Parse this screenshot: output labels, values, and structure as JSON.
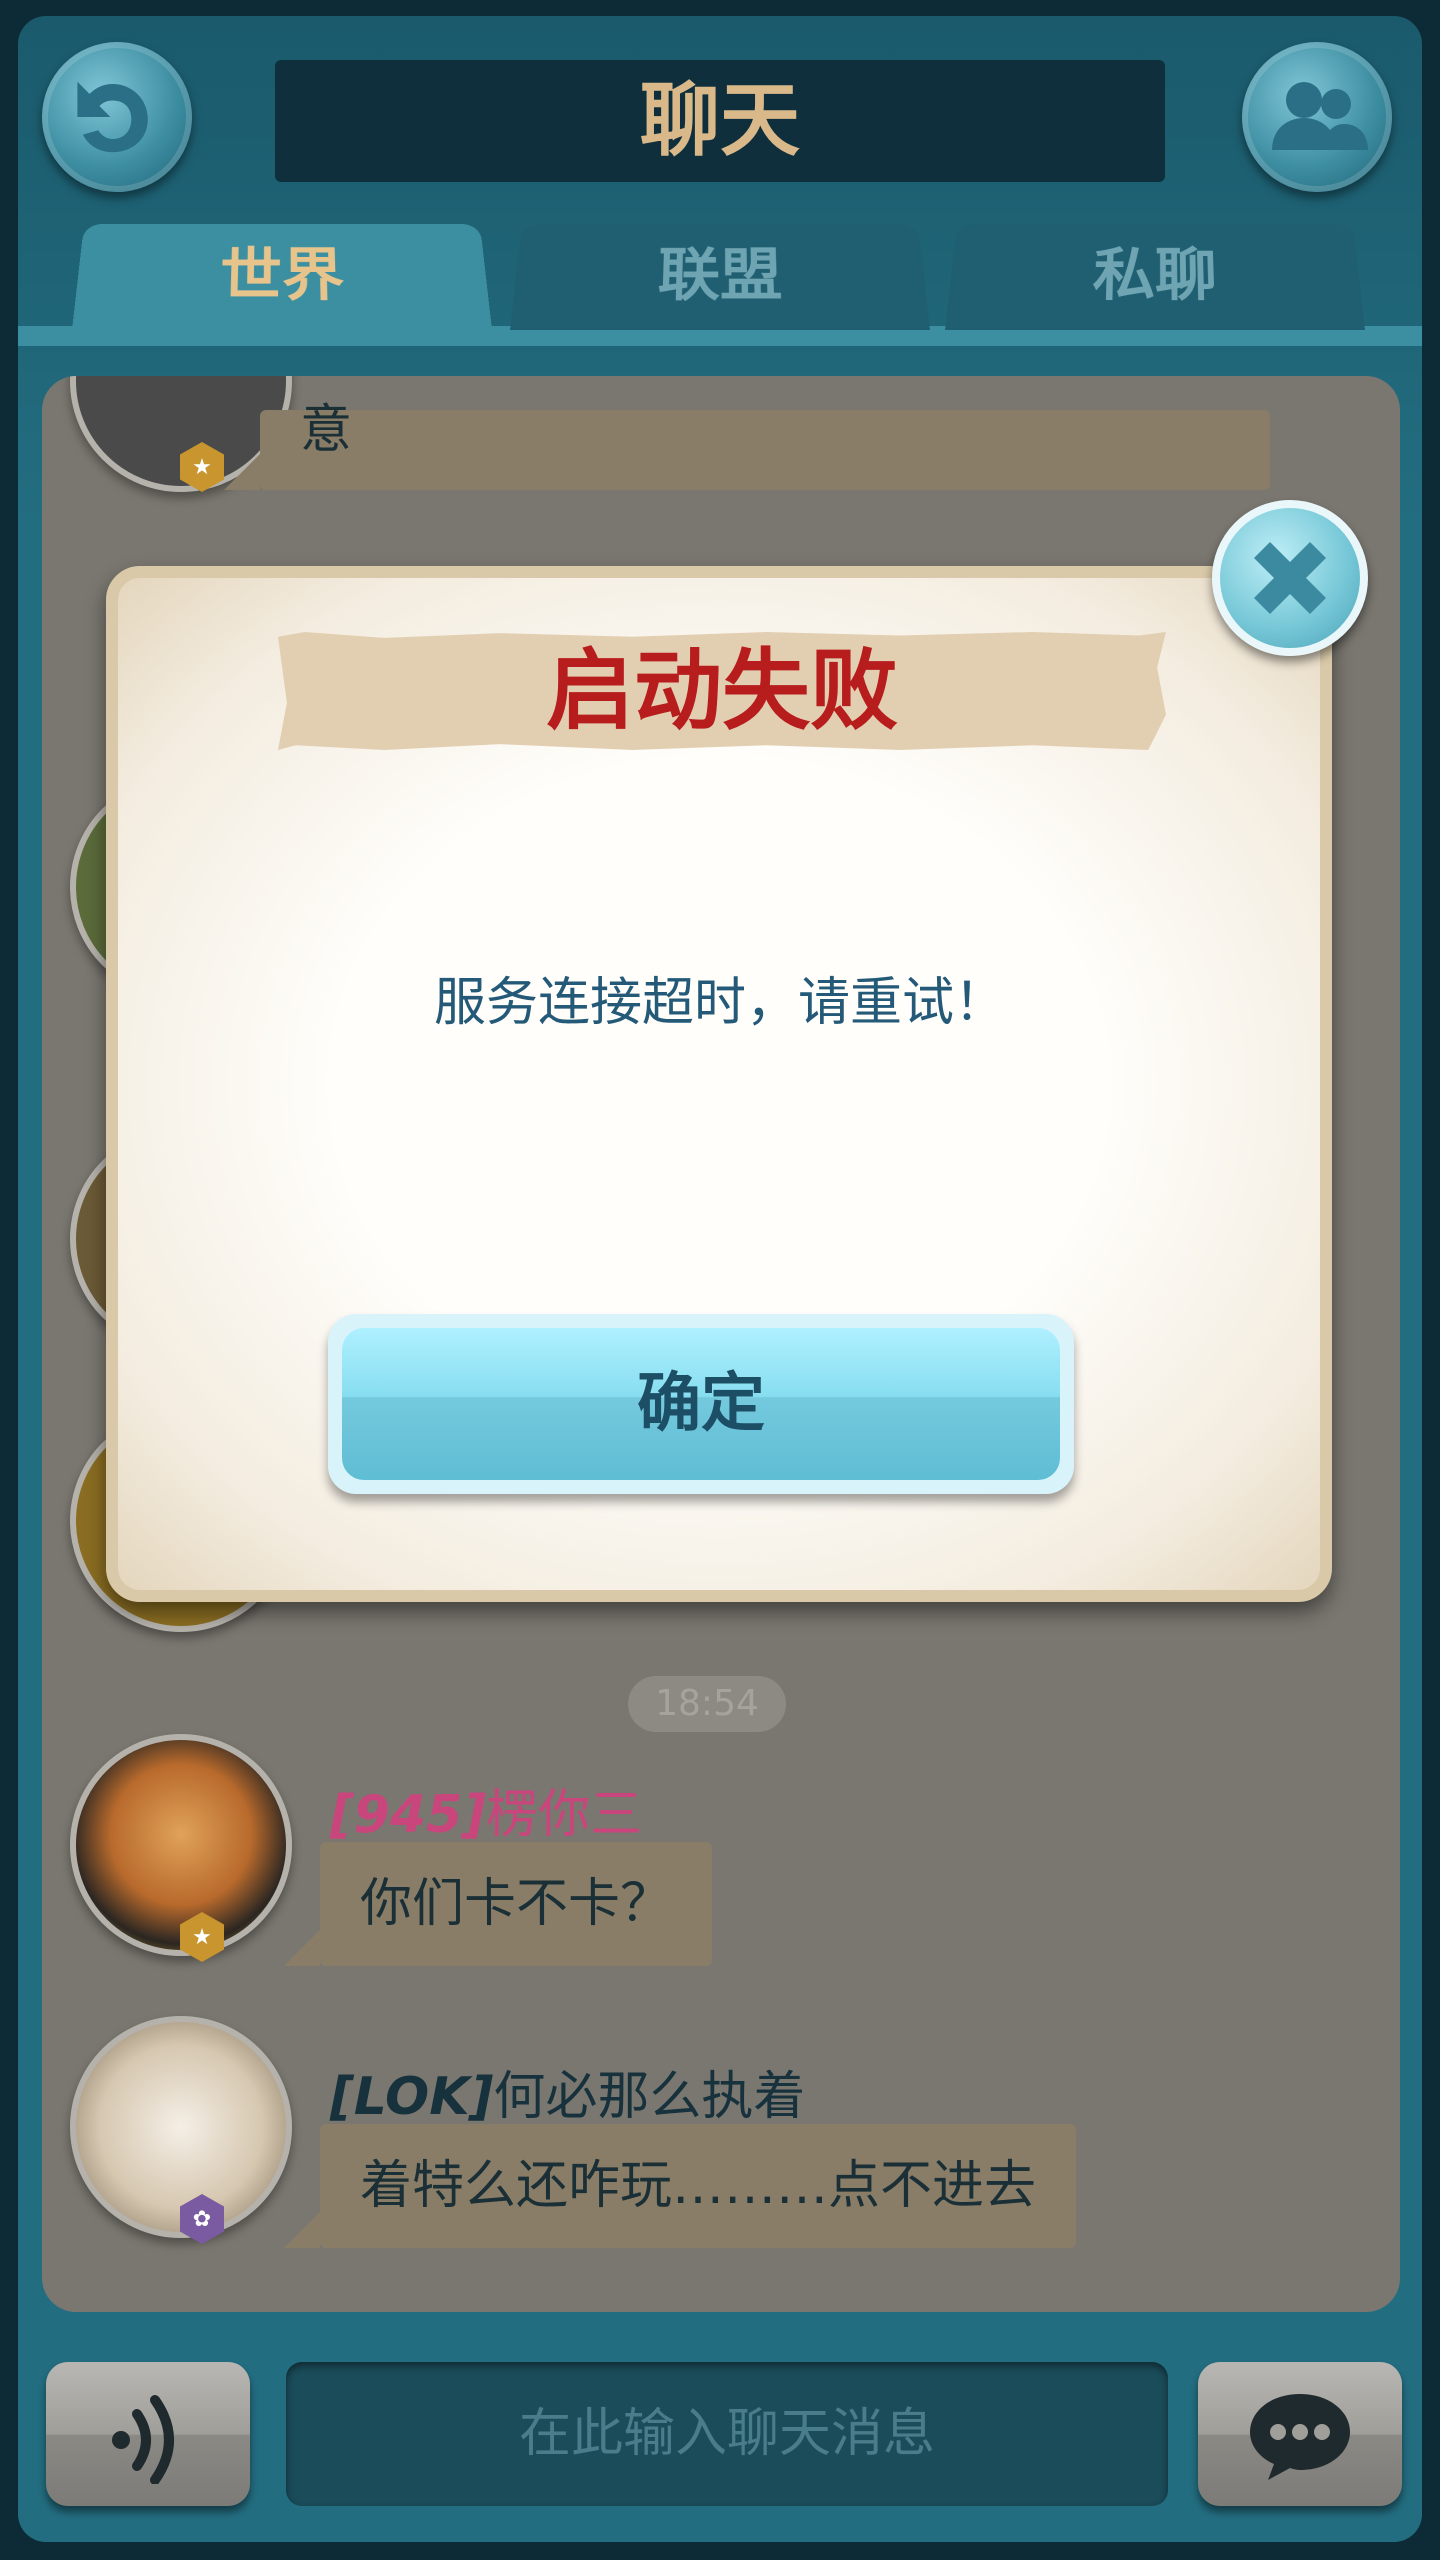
{
  "header": {
    "title": "聊天"
  },
  "tabs": [
    {
      "label": "世界",
      "active": true
    },
    {
      "label": "联盟",
      "active": false
    },
    {
      "label": "私聊",
      "active": false
    }
  ],
  "chat": {
    "top_partial_message": "意",
    "timestamp": "18:54",
    "messages": [
      {
        "tag": "[945]",
        "name": "楞你三",
        "text": "你们卡不卡？",
        "tag_color": "#c8467c",
        "name_color": "#c8467c"
      },
      {
        "tag": "[LOK]",
        "name": "何必那么执着",
        "text": "着特么还咋玩………点不进去",
        "tag_color": "#17323c",
        "name_color": "#17323c"
      }
    ]
  },
  "dialog": {
    "title": "启动失败",
    "message": "服务连接超时，请重试！",
    "confirm_label": "确定"
  },
  "input": {
    "placeholder": "在此输入聊天消息"
  },
  "icons": {
    "back": "back-arrow-icon",
    "friends": "friends-icon",
    "close": "close-icon",
    "voice": "voice-icon",
    "send": "chat-bubble-icon"
  }
}
